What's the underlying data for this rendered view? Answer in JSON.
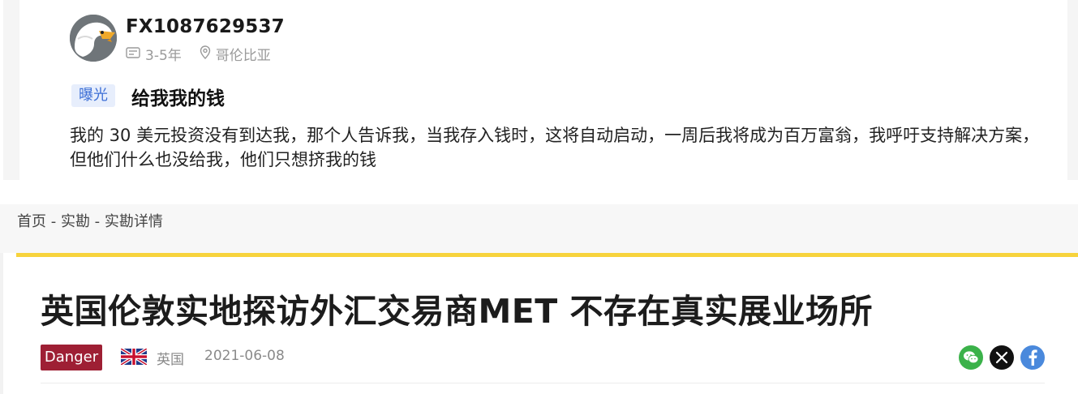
{
  "comment": {
    "username": "FX1087629537",
    "experience": "3-5年",
    "location": "哥伦比亚",
    "tag": "曝光",
    "title": "给我我的钱",
    "body": "我的 30 美元投资没有到达我，那个人告诉我，当我存入钱时，这将自动启动，一周后我将成为百万富翁，我呼吁支持解决方案，但他们什么也没给我，他们只想挤我的钱"
  },
  "breadcrumb": {
    "home": "首页",
    "sep1": " - ",
    "section": "实勘",
    "sep2": " - ",
    "current": "实勘详情"
  },
  "article": {
    "title": "英国伦敦实地探访外汇交易商MET 不存在真实展业场所",
    "badge": "Danger",
    "badge_color": "#9e1f34",
    "country": "英国",
    "date": "2021-06-08",
    "accent_color": "#f7d33c",
    "share_icons": [
      "wechat-icon",
      "x-icon",
      "facebook-icon"
    ]
  }
}
